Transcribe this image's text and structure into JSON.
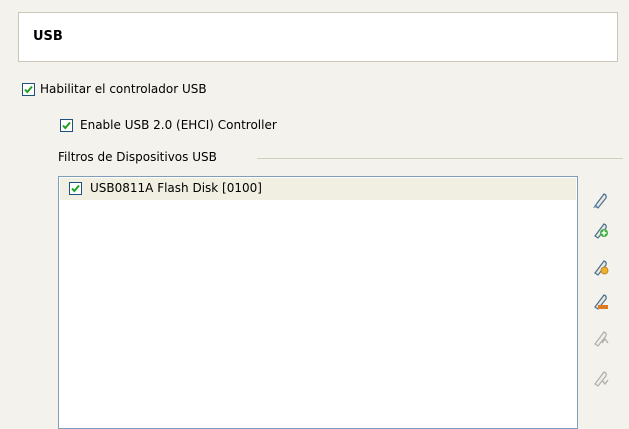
{
  "header": {
    "title": "USB"
  },
  "options": {
    "enable_controller_label": "Habilitar el controlador USB",
    "enable_controller_checked": true,
    "enable_ehci_label": "Enable USB 2.0 (EHCI) Controller",
    "enable_ehci_checked": true
  },
  "filters": {
    "group_label": "Filtros de Dispositivos USB",
    "items": [
      {
        "label": "USB0811A Flash Disk [0100]",
        "checked": true
      }
    ]
  },
  "toolbar": {
    "buttons": [
      {
        "icon": "add-filter-icon",
        "enabled": true
      },
      {
        "icon": "add-from-device-icon",
        "enabled": true
      },
      {
        "icon": "edit-filter-icon",
        "enabled": true
      },
      {
        "icon": "remove-filter-icon",
        "enabled": true
      },
      {
        "icon": "move-up-icon",
        "enabled": false
      },
      {
        "icon": "move-down-icon",
        "enabled": false
      }
    ]
  },
  "colors": {
    "background": "#f3f2ec",
    "check_mark": "#21a121",
    "checkbox_border": "#1c5180",
    "list_border": "#7f9db9",
    "selected_row": "#f1efe2"
  }
}
